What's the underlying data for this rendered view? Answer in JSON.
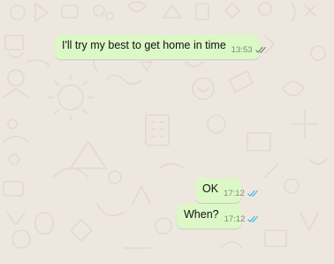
{
  "chat": {
    "background_color": "#EDE7DF",
    "bubble_color": "#DCF8C6",
    "messages": [
      {
        "text": "I'll try my best to get home in time",
        "time": "13:53",
        "status": "read",
        "status_icon": "double-check-icon",
        "tick_color": "#6b7d6a"
      },
      {
        "text": "OK",
        "time": "17:12",
        "status": "read",
        "status_icon": "double-check-icon",
        "tick_color": "#34B7F1"
      },
      {
        "text": "When?",
        "time": "17:12",
        "status": "read",
        "status_icon": "double-check-icon",
        "tick_color": "#34B7F1"
      }
    ]
  }
}
